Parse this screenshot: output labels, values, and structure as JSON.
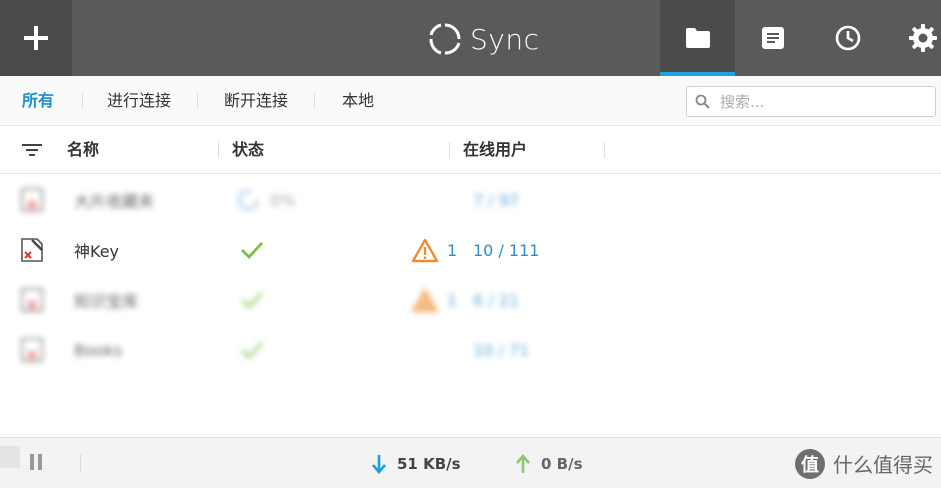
{
  "header": {
    "app_name": "Sync",
    "add_icon": "plus-icon",
    "nav": [
      {
        "icon": "folder-icon",
        "active": true
      },
      {
        "icon": "document-icon",
        "active": false
      },
      {
        "icon": "clock-icon",
        "active": false
      },
      {
        "icon": "gear-icon",
        "active": false
      }
    ]
  },
  "filters": {
    "tabs": [
      "所有",
      "进行连接",
      "断开连接",
      "本地"
    ],
    "active_index": 0
  },
  "search": {
    "placeholder": "搜索..."
  },
  "columns": {
    "name": "名称",
    "status": "状态",
    "online_users": "在线用户"
  },
  "rows": [
    {
      "name": "大片收藏夹",
      "status": "0%",
      "warn_count": "",
      "users": "7 / 97",
      "blurred": true,
      "status_type": "progress"
    },
    {
      "name": "神Key",
      "status": "",
      "warn_count": "1",
      "users": "10 / 111",
      "blurred": false,
      "status_type": "ok"
    },
    {
      "name": "知识宝库",
      "status": "",
      "warn_count": "1",
      "users": "6 / 21",
      "blurred": true,
      "status_type": "ok"
    },
    {
      "name": "Books",
      "status": "",
      "warn_count": "",
      "users": "10 / 71",
      "blurred": true,
      "status_type": "ok"
    }
  ],
  "footer": {
    "download_rate": "51 KB/s",
    "upload_rate": "0 B/s",
    "watermark_logo": "值",
    "watermark_text": "什么值得买"
  },
  "colors": {
    "accent": "#1fa3dc",
    "header_bg": "#5a5a5a",
    "ok_green": "#7cc242",
    "warn_orange": "#f08c2e",
    "download_blue": "#1a9ee0",
    "upload_green": "#8cc874"
  }
}
